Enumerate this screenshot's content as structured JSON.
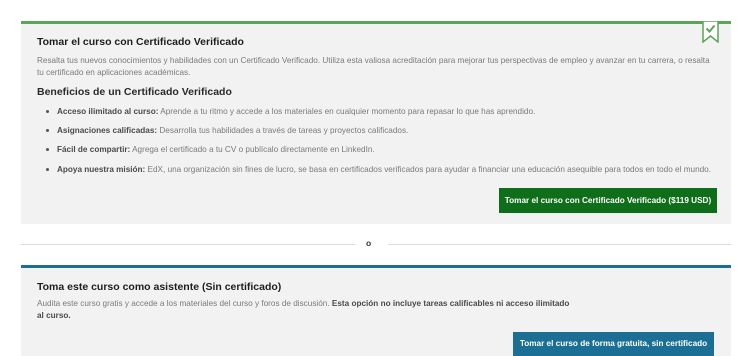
{
  "verified": {
    "title": "Tomar el curso con Certificado Verificado",
    "description": "Resalta tus nuevos conocimientos y habilidades con un Certificado Verificado. Utiliza esta valiosa acreditación para mejorar tus perspectivas de empleo y avanzar en tu carrera, o resalta tu certificado en aplicaciones académicas.",
    "benefits_title": "Beneficios de un Certificado Verificado",
    "benefits": [
      {
        "name": "Acceso ilimitado al curso:",
        "text": " Aprende a tu ritmo y accede a los materiales en cualquier momento para repasar lo que has aprendido."
      },
      {
        "name": "Asignaciones calificadas:",
        "text": " Desarrolla tus habilidades a través de tareas y proyectos calificados."
      },
      {
        "name": "Fácil de compartir:",
        "text": " Agrega el certificado a tu CV o publícalo directamente en LinkedIn."
      },
      {
        "name": "Apoya nuestra misión:",
        "text": " EdX, una organización sin fines de lucro, se basa en certificados verificados para ayudar a financiar una educación asequible para todos en todo el mundo."
      }
    ],
    "button_label": "Tomar el curso con Certificado Verificado ($119 USD)",
    "accent_color": "#5aa55a",
    "button_color": "#0f6e1a"
  },
  "separator": {
    "label": "o"
  },
  "audit": {
    "title": "Toma este curso como asistente (Sin certificado)",
    "description": "Audita este curso gratis y accede a los materiales del curso y foros de discusión.",
    "description_bold": "Esta opción no incluye tareas calificables ni acceso ilimitado al curso.",
    "button_label": "Tomar el curso de forma gratuita, sin certificado",
    "accent_color": "#1b6f94"
  },
  "icons": {
    "ribbon": "certificate-ribbon-icon"
  }
}
